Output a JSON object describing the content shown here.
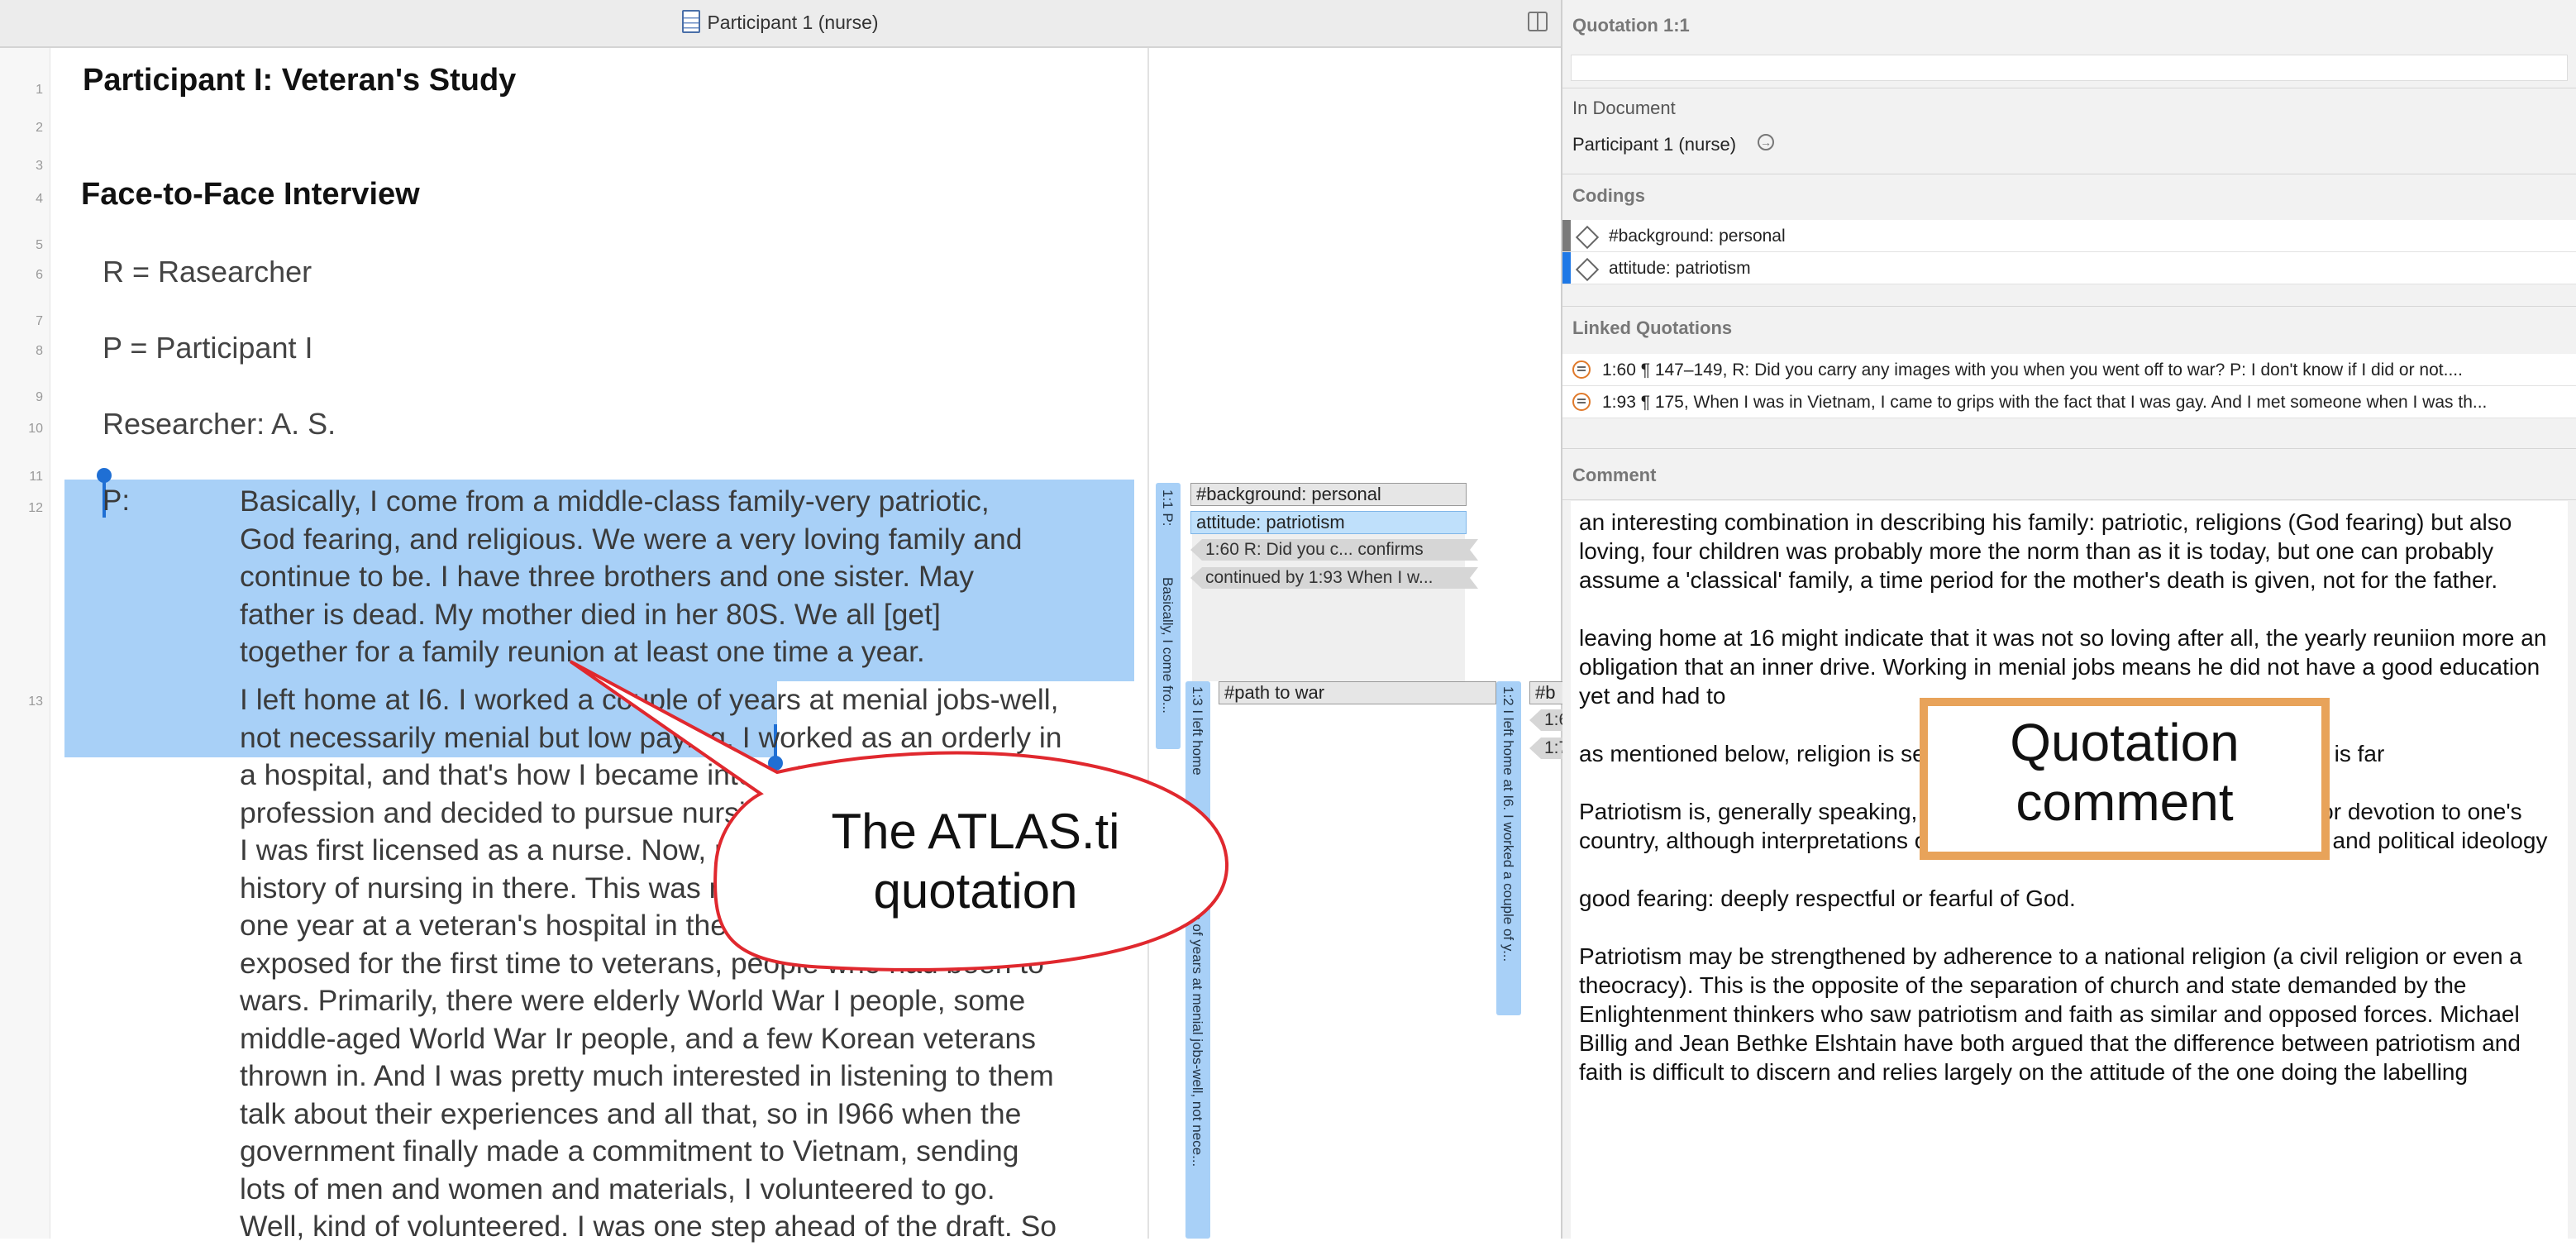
{
  "titlebar": {
    "document_title": "Participant 1 (nurse)"
  },
  "line_numbers": [
    "1",
    "2",
    "3",
    "4",
    "5",
    "6",
    "7",
    "8",
    "9",
    "10",
    "11",
    "12",
    "13"
  ],
  "document": {
    "title": "Participant I: Veteran's Study",
    "subtitle": "Face-to-Face Interview",
    "r_line": "R = Rasearcher",
    "p_line": "P = Participant I",
    "researcher_line": "Researcher: A. S.",
    "speaker": "P:",
    "para1_lines": [
      "Basically, I come from a middle-class family-very patriotic,",
      "God fearing, and religious. We were a very loving family and",
      "continue to be. I have three brothers and one sister. May",
      "father is dead. My mother died in her 80S. We all [get]",
      "together for a family reunion at least one time a year."
    ],
    "para2_lines": [
      "I left home at I6. I worked a couple of years at menial jobs-well,",
      "not necessarily menial but low paying. I worked as an orderly in",
      "a hospital, and that's how I became interested in the",
      "profession and decided to pursue nursing. In 1961",
      "I was first licensed as a nurse. Now, my",
      "history of nursing in there. This was my",
      "one year at a veteran's hospital in the",
      "exposed for the first time to veterans, people who had been to",
      "wars. Primarily, there were elderly World War I people, some",
      "middle-aged World War Ir people, and a few Korean veterans",
      "thrown in. And I was pretty much interested in listening to them",
      "talk about their experiences and all that, so in I966 when the",
      "government finally made a commitment to Vietnam, sending",
      "lots of men and women and materials, I volunteered to go.",
      "Well, kind of volunteered. I was one step ahead of the draft. So"
    ]
  },
  "margin": {
    "q1_label": "1:1 P:",
    "q1_label2": "Basically, I come fro...",
    "q3_label": "1:3 I left home",
    "q3_label2": "ple of years at menial jobs-well, not nece...",
    "q2_label": "1:2 I left home at I6. I worked a couple of y...",
    "codes": [
      "#background: personal",
      "attitude: patriotism"
    ],
    "link1": "1:60 R:   Did you c... confirms",
    "link2": "continued by 1:93  When I w...",
    "path_code": "#path to war",
    "cut_code": "#b",
    "cut_link1": "1:6",
    "cut_link2": "1:7"
  },
  "inspector": {
    "quotation_title": "Quotation 1:1",
    "in_document_label": "In Document",
    "document_name": "Participant 1 (nurse)",
    "codings_label": "Codings",
    "codings": [
      {
        "label": "#background: personal",
        "color": "#7a7a7a"
      },
      {
        "label": "attitude: patriotism",
        "color": "#1e78e6"
      }
    ],
    "linked_label": "Linked Quotations",
    "linked": [
      "1:60 ¶ 147–149, R:   Did you carry any images with you when you went off to war? P:   I don't know if I did or not....",
      "1:93 ¶ 175, When I was in Vietnam, I came to grips with the fact that I was gay. And I met someone when I was th..."
    ],
    "comment_label": "Comment",
    "comment_paragraphs": [
      "an interesting combination in describing his family: patriotic, religions (God fearing) but also loving, four children was probably more the norm than as it is today, but one can probably assume a 'classical' family, a time period for the mother's death is given, not for the father.",
      "leaving home at 16 might indicate that it was not so loving after all, the yearly reuniion more an obligation that an inner drive. Working in menial jobs means he did not have a good education yet and had to",
      "as mentioned below, religion is                                                 se thoughts that came with enlightenment is far",
      "Patriotism is, generally speaking, cultural attachment to one's homeland or devotion to one's country, although interpretations of the term vary with context, geography and political ideology",
      "good fearing: deeply respectful or fearful of God.",
      "Patriotism may be strengthened by adherence to a national religion (a civil religion or even a theocracy). This is the opposite of the separation of church and state demanded by the Enlightenment thinkers who saw patriotism and faith as similar and opposed forces. Michael Billig and Jean Bethke Elshtain have both argued that the difference between patriotism and faith is difficult to discern and relies largely on the attitude of the one doing the labelling"
    ]
  },
  "annotations": {
    "callout_line1": "The ATLAS.ti",
    "callout_line2": "quotation",
    "comment_callout_line1": "Quotation",
    "comment_callout_line2": "comment",
    "callout_color": "#e0282e",
    "comment_box_color": "#e8a35a"
  }
}
